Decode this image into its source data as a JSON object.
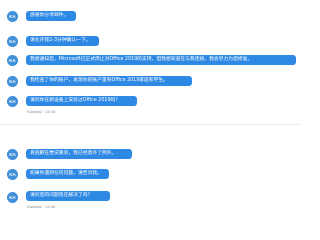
{
  "messages": [
    {
      "avatar": "KA",
      "text": "感谢你分享邮件。"
    },
    {
      "avatar": "KA",
      "text": "请允许我2-3分钟确认一下。"
    },
    {
      "avatar": "KA",
      "text": "我想通知您，Microsoft已正式停止对Office 2019的支持，但我想知道在与我连接。我会尽力为您修复。"
    },
    {
      "avatar": "KA",
      "text": "我检查了你的账户，发现你的账户里有Office 2019家庭和学生。"
    },
    {
      "avatar": "KA",
      "text": "请问你在新设备上安装过Office 2019吗？"
    },
    {
      "avatar": "KA",
      "text": "真抱歉在尝试重装，我已经意外了例外。"
    },
    {
      "avatar": "KA",
      "text": "如果你遇到任何问题，请告诉我。"
    },
    {
      "avatar": "KA",
      "text": "请问您的问题现在解决了吗？"
    }
  ],
  "meta": [
    {
      "sender": "Kaushal",
      "time": "13:43"
    },
    {
      "sender": "Kaushal",
      "time": "13:46"
    }
  ],
  "colors": {
    "bubble": "#2e89e5",
    "avatar": "#3f8fd9"
  }
}
